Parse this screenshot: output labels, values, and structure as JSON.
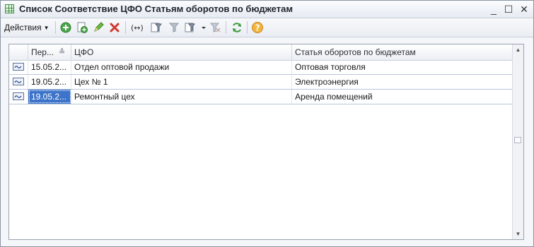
{
  "window": {
    "title": "Список Соответствие ЦФО Статьям оборотов по бюджетам",
    "controls": {
      "min": "_",
      "max": "☐",
      "close": "✕"
    }
  },
  "toolbar": {
    "actions_label": "Действия",
    "icons": [
      "add-icon",
      "copy-icon",
      "edit-icon",
      "delete-icon",
      "range-icon",
      "filter-icon",
      "filter-off-icon",
      "filter-list-icon",
      "clear-filter-icon",
      "refresh-icon",
      "help-icon"
    ]
  },
  "table": {
    "columns": [
      {
        "label": "Пер..."
      },
      {
        "label": "ЦФО"
      },
      {
        "label": "Статья оборотов по бюджетам"
      }
    ],
    "sort_indicator": "≙",
    "rows": [
      {
        "period": "15.05.2...",
        "cfo": "Отдел оптовой продажи",
        "article": "Оптовая торговля",
        "selected": false
      },
      {
        "period": "19.05.2...",
        "cfo": "Цех № 1",
        "article": "Электроэнергия",
        "selected": false
      },
      {
        "period": "19.05.2...",
        "cfo": "Ремонтный цех",
        "article": "Аренда помещений",
        "selected": true
      }
    ]
  },
  "colors": {
    "selection": "#3d74c9",
    "row_line": "#b8c7da",
    "accent_green": "#3e8f3e"
  }
}
